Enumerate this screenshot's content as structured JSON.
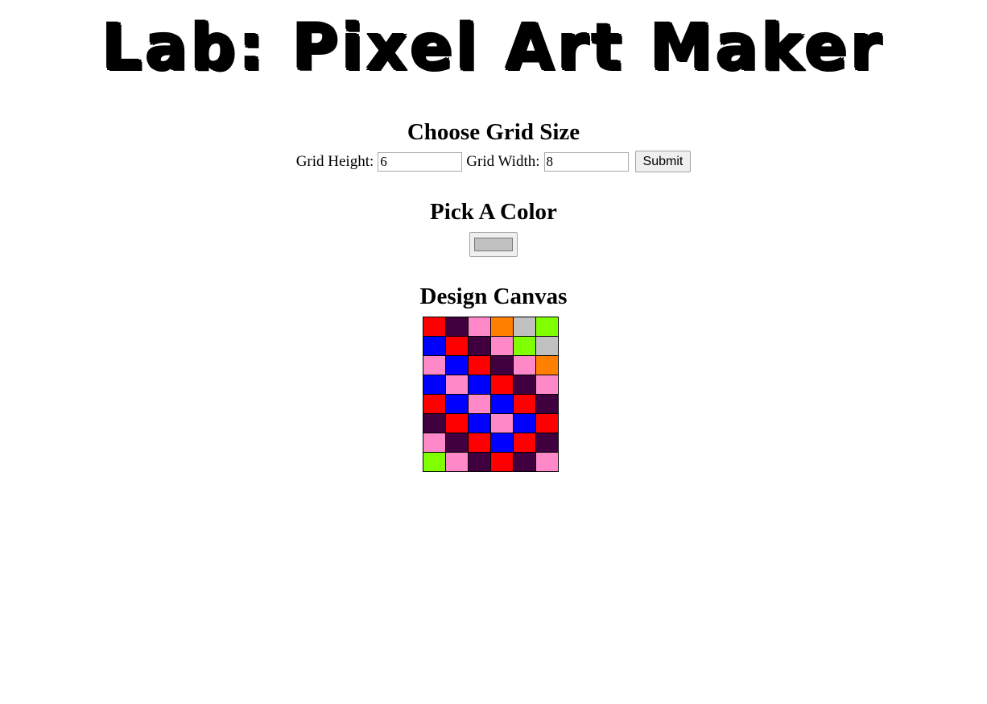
{
  "page": {
    "title": "Lab: Pixel Art Maker"
  },
  "grid_size": {
    "heading": "Choose Grid Size",
    "height_label": "Grid Height:",
    "height_value": "6",
    "width_label": "Grid Width:",
    "width_value": "8",
    "submit_label": "Submit"
  },
  "color_picker": {
    "heading": "Pick A Color",
    "selected_color": "#c0c0c0"
  },
  "canvas": {
    "heading": "Design Canvas",
    "colors": {
      "R": "#ff0000",
      "P": "#400040",
      "K": "#ff88c8",
      "O": "#ff8000",
      "G": "#c0c0c0",
      "L": "#80ff00",
      "B": "#0000ff"
    },
    "rows": [
      [
        "R",
        "P",
        "K",
        "O",
        "G",
        "L"
      ],
      [
        "B",
        "R",
        "P",
        "K",
        "L",
        "G"
      ],
      [
        "K",
        "B",
        "R",
        "P",
        "K",
        "O"
      ],
      [
        "B",
        "K",
        "B",
        "R",
        "P",
        "K"
      ],
      [
        "R",
        "B",
        "K",
        "B",
        "R",
        "P"
      ],
      [
        "P",
        "R",
        "B",
        "K",
        "B",
        "R"
      ],
      [
        "K",
        "P",
        "R",
        "B",
        "R",
        "P"
      ],
      [
        "L",
        "K",
        "P",
        "R",
        "P",
        "K"
      ]
    ]
  }
}
